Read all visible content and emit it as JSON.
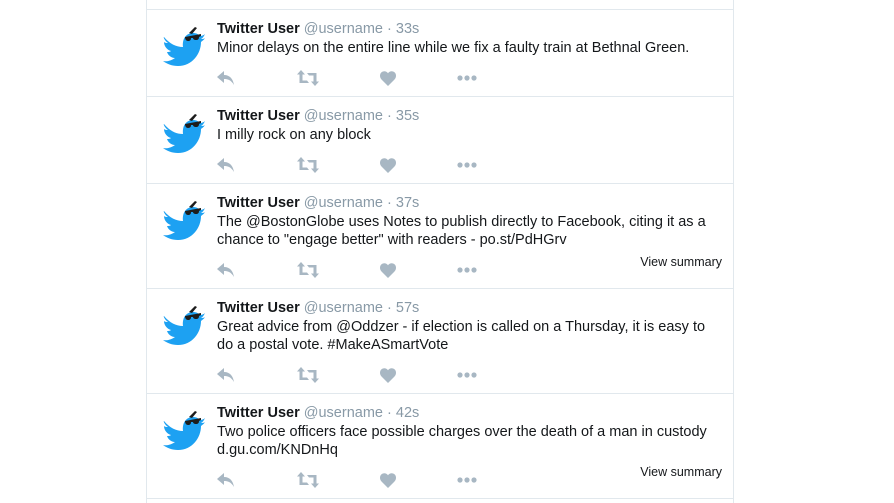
{
  "tweets": [
    {
      "name": "Twitter User",
      "handle": "@username",
      "sep": "·",
      "time": "33s",
      "text": "Minor delays on the entire line while we fix a faulty train at Bethnal Green.",
      "summary": ""
    },
    {
      "name": "Twitter User",
      "handle": "@username",
      "sep": "·",
      "time": "35s",
      "text": "I milly rock on any block",
      "summary": ""
    },
    {
      "name": "Twitter User",
      "handle": "@username",
      "sep": "·",
      "time": "37s",
      "text": "The @BostonGlobe uses Notes to publish directly to Facebook, citing it as a chance to \"engage better\" with readers - po.st/PdHGrv",
      "summary": "View summary"
    },
    {
      "name": "Twitter User",
      "handle": "@username",
      "sep": "·",
      "time": "57s",
      "text": "Great advice from @Oddzer - if election is called on a Thursday, it is easy to do a postal vote. #MakeASmartVote",
      "summary": ""
    },
    {
      "name": "Twitter User",
      "handle": "@username",
      "sep": "·",
      "time": "42s",
      "text": "Two police officers face possible charges over the death of a man in custody d.gu.com/KNDnHq",
      "summary": "View summary"
    }
  ],
  "icons": {
    "avatar": "twitter-bird-with-sunglasses-icon",
    "reply": "reply-icon",
    "retweet": "retweet-icon",
    "like": "heart-icon",
    "more": "more-dots-icon"
  },
  "colors": {
    "brand": "#1da1f2",
    "action_icon": "#a8b7c3",
    "muted_text": "#8899a6",
    "divider": "#e1e8ed"
  }
}
